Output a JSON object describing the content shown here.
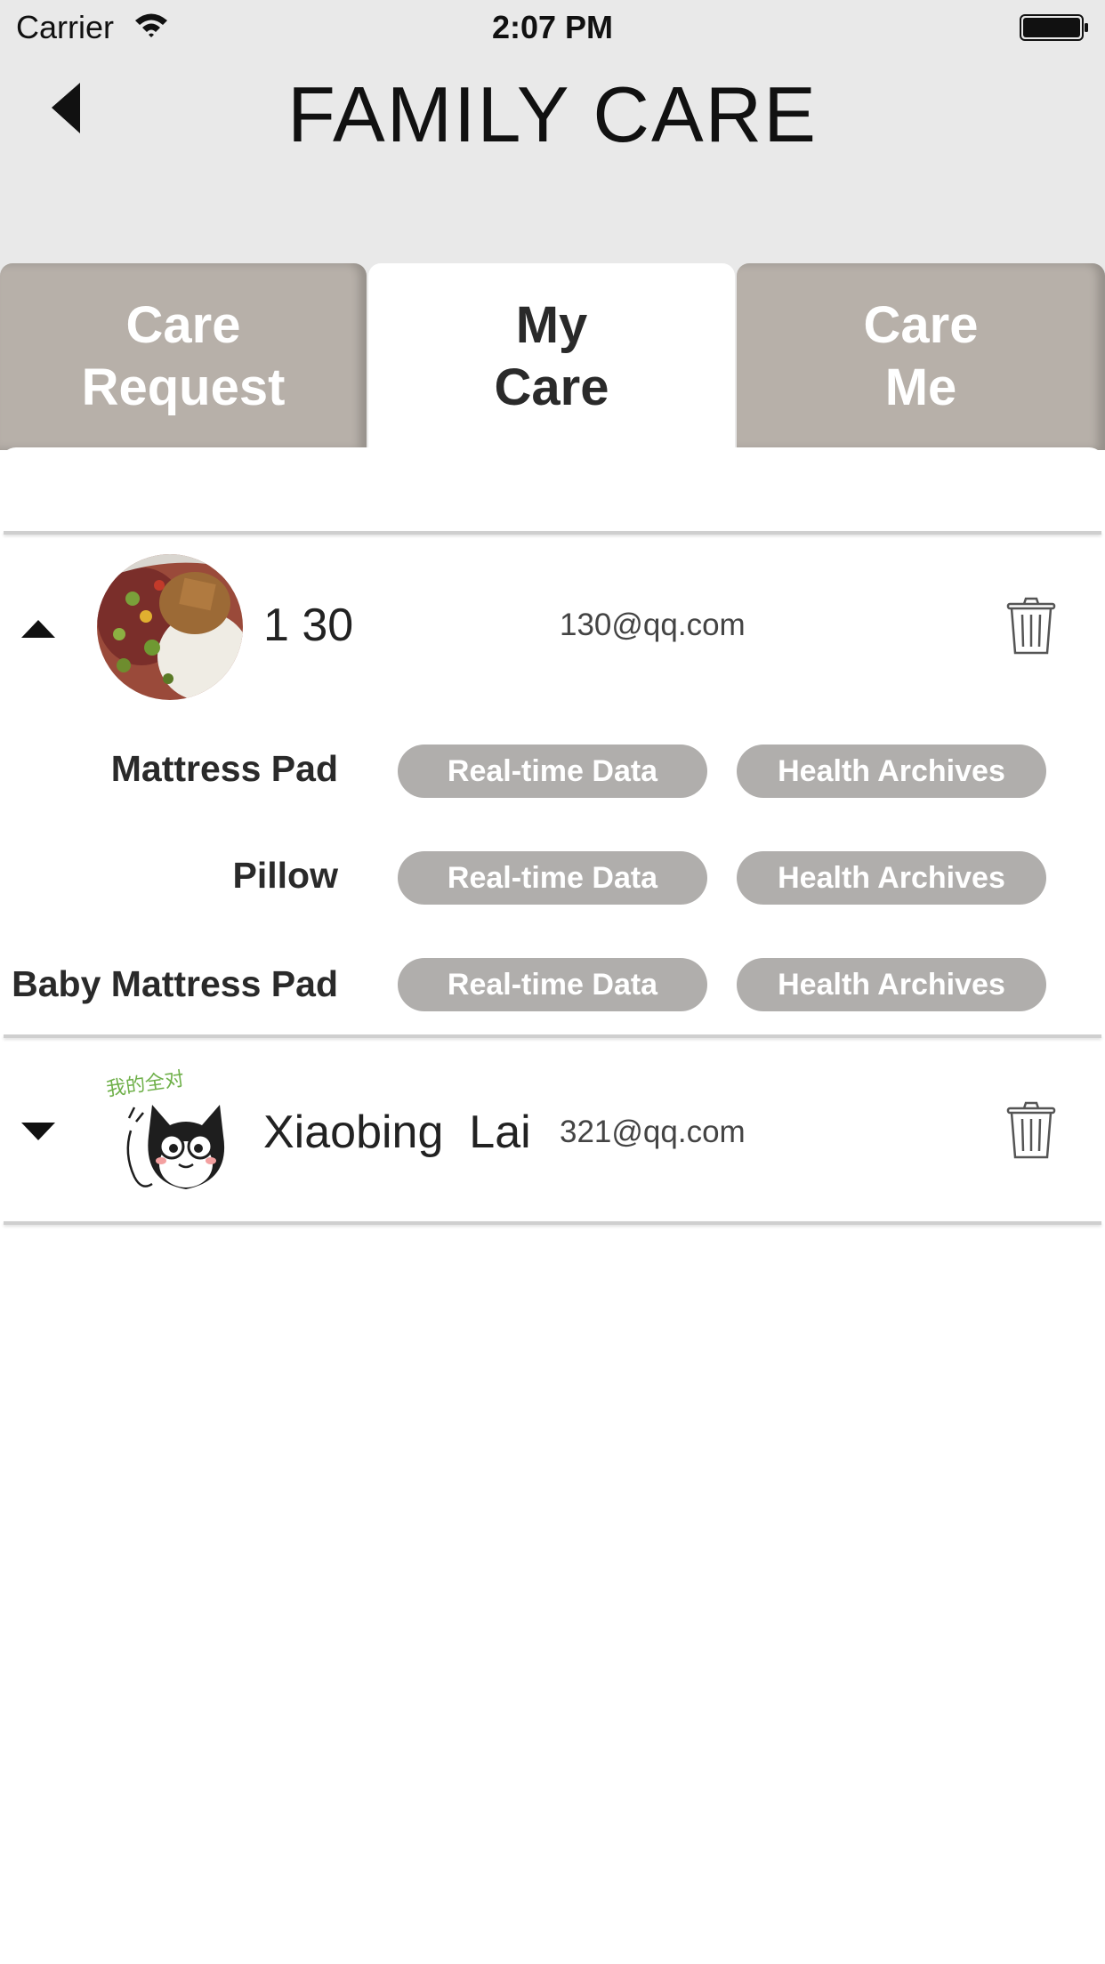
{
  "status_bar": {
    "carrier": "Carrier",
    "time": "2:07 PM"
  },
  "header": {
    "title": "FAMILY CARE"
  },
  "tabs": [
    {
      "label": "Care\nRequest",
      "active": false
    },
    {
      "label": "My\nCare",
      "active": true
    },
    {
      "label": "Care\nMe",
      "active": false
    }
  ],
  "contacts": [
    {
      "name": "1 30",
      "email": "130@qq.com",
      "expanded": true,
      "avatar": "food-photo",
      "devices": [
        {
          "label": "Mattress Pad",
          "realtime": "Real-time Data",
          "archives": "Health Archives"
        },
        {
          "label": "Pillow",
          "realtime": "Real-time Data",
          "archives": "Health Archives"
        },
        {
          "label": "Baby Mattress Pad",
          "realtime": "Real-time Data",
          "archives": "Health Archives"
        }
      ]
    },
    {
      "name": "Xiaobing  Lai",
      "email": "321@qq.com",
      "expanded": false,
      "avatar": "cartoon-cat",
      "avatar_caption": "我的全对"
    }
  ],
  "colors": {
    "header_bg": "#e9e9e9",
    "inactive_tab": "#b7b0a9",
    "pill_bg": "#b0aeac",
    "divider": "#cfcfcf"
  },
  "icons": [
    "back-arrow-icon",
    "wifi-icon",
    "battery-icon",
    "caret-up-icon",
    "caret-down-icon",
    "trash-icon"
  ]
}
